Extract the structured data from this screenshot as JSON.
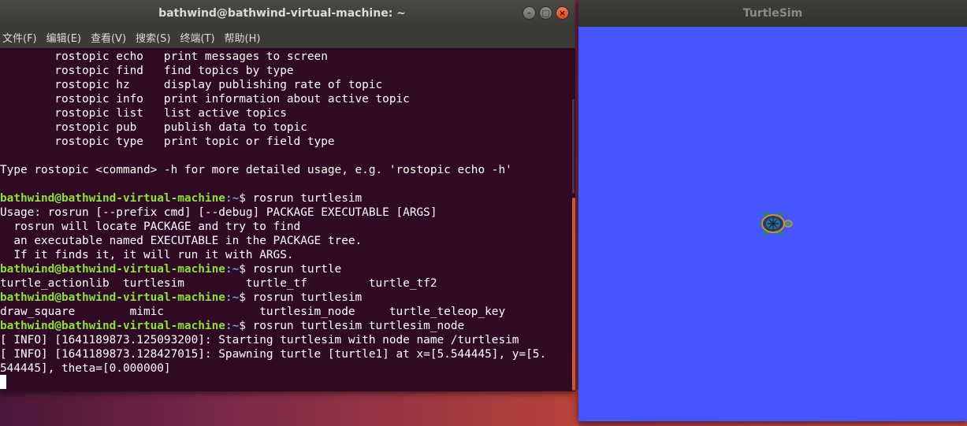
{
  "terminal": {
    "title": "bathwind@bathwind-virtual-machine: ~",
    "menu": [
      "文件(F)",
      "编辑(E)",
      "查看(V)",
      "搜索(S)",
      "终端(T)",
      "帮助(H)"
    ],
    "window_buttons": {
      "minimize": "–",
      "maximize": "□",
      "close": "×"
    },
    "lines": [
      {
        "text": "        rostopic echo   print messages to screen"
      },
      {
        "text": "        rostopic find   find topics by type"
      },
      {
        "text": "        rostopic hz     display publishing rate of topic"
      },
      {
        "text": "        rostopic info   print information about active topic"
      },
      {
        "text": "        rostopic list   list active topics"
      },
      {
        "text": "        rostopic pub    publish data to topic"
      },
      {
        "text": "        rostopic type   print topic or field type"
      },
      {
        "text": ""
      },
      {
        "text": "Type rostopic <command> -h for more detailed usage, e.g. 'rostopic echo -h'"
      },
      {
        "text": ""
      },
      {
        "prompt": "bathwind@bathwind-virtual-machine",
        "path": ":~",
        "cmd": "$ rosrun turtlesim"
      },
      {
        "text": "Usage: rosrun [--prefix cmd] [--debug] PACKAGE EXECUTABLE [ARGS]"
      },
      {
        "text": "  rosrun will locate PACKAGE and try to find"
      },
      {
        "text": "  an executable named EXECUTABLE in the PACKAGE tree."
      },
      {
        "text": "  If it finds it, it will run it with ARGS."
      },
      {
        "prompt": "bathwind@bathwind-virtual-machine",
        "path": ":~",
        "cmd": "$ rosrun turtle"
      },
      {
        "text": "turtle_actionlib  turtlesim         turtle_tf         turtle_tf2"
      },
      {
        "prompt": "bathwind@bathwind-virtual-machine",
        "path": ":~",
        "cmd": "$ rosrun turtlesim"
      },
      {
        "text": "draw_square        mimic              turtlesim_node     turtle_teleop_key"
      },
      {
        "prompt": "bathwind@bathwind-virtual-machine",
        "path": ":~",
        "cmd": "$ rosrun turtlesim turtlesim_node"
      },
      {
        "text": "[ INFO] [1641189873.125093200]: Starting turtlesim with node name /turtlesim"
      },
      {
        "text": "[ INFO] [1641189873.128427015]: Spawning turtle [turtle1] at x=[5.544445], y=[5."
      },
      {
        "text": "544445], theta=[0.000000]"
      }
    ]
  },
  "turtlesim": {
    "title": "TurtleSim",
    "background": "#4556ff",
    "turtle_icon": "turtle-icon"
  }
}
